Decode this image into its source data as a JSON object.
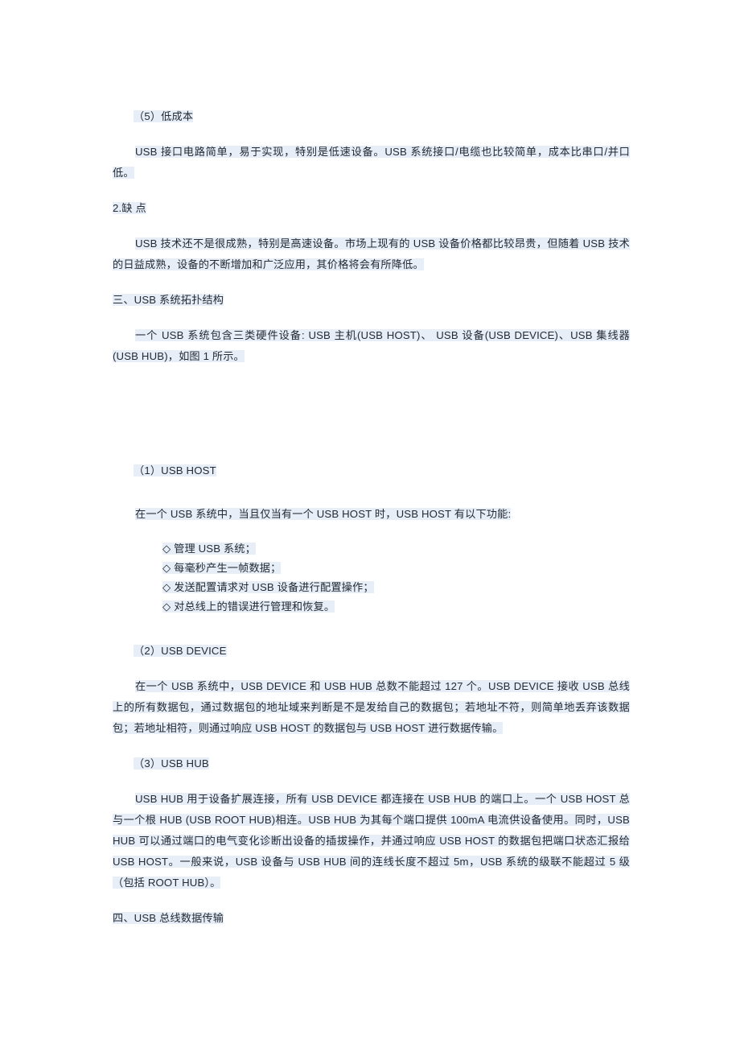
{
  "document": {
    "language": "zh-CN",
    "highlight_color": "#e7eef8",
    "text_color": "#262b33",
    "background_color": "#ffffff"
  },
  "blocks": {
    "low_cost_heading": "（5）低成本",
    "low_cost_body": "USB 接口电路简单，易于实现，特别是低速设备。USB 系统接口/电缆也比较简单，成本比串口/并口低。",
    "disadvantages_heading": "2.缺 点",
    "disadvantages_body": "USB 技术还不是很成熟，特别是高速设备。市场上现有的 USB 设备价格都比较昂贵，但随着 USB 技术的日益成熟，设备的不断增加和广泛应用，其价格将会有所降低。",
    "topology_heading": "三、USB 系统拓扑结构",
    "topology_body": "一个 USB 系统包含三类硬件设备: USB 主机(USB HOST)、 USB 设备(USB DEVICE)、USB 集线器(USB HUB)，如图 1 所示。",
    "usb_host_heading": "（1）USB HOST",
    "usb_host_body": "在一个 USB 系统中，当且仅当有一个 USB HOST 时，USB HOST 有以下功能:",
    "usb_host_functions": [
      "◇ 管理 USB 系统；",
      "◇ 每毫秒产生一帧数据；",
      "◇ 发送配置请求对 USB 设备进行配置操作；",
      "◇ 对总线上的错误进行管理和恢复。"
    ],
    "usb_device_heading": "（2）USB DEVICE",
    "usb_device_body": "在一个 USB 系统中，USB DEVICE 和 USB HUB 总数不能超过 127 个。USB DEVICE 接收 USB 总线上的所有数据包，通过数据包的地址域来判断是不是发给自己的数据包；若地址不符，则简单地丢弃该数据包；若地址相符，则通过响应 USB HOST 的数据包与 USB HOST 进行数据传输。",
    "usb_hub_heading": "（3）USB HUB",
    "usb_hub_body": "USB HUB 用于设备扩展连接，所有 USB DEVICE 都连接在 USB HUB 的端口上。一个 USB HOST 总与一个根 HUB (USB ROOT HUB)相连。USB HUB 为其每个端口提供 100mA 电流供设备使用。同时，USB HUB 可以通过端口的电气变化诊断出设备的插拔操作，并通过响应 USB HOST 的数据包把端口状态汇报给 USB HOST。一般来说，USB 设备与 USB HUB 间的连线长度不超过 5m，USB 系统的级联不能超过 5 级（包括 ROOT HUB）。",
    "data_transfer_heading": "四、USB 总线数据传输"
  }
}
